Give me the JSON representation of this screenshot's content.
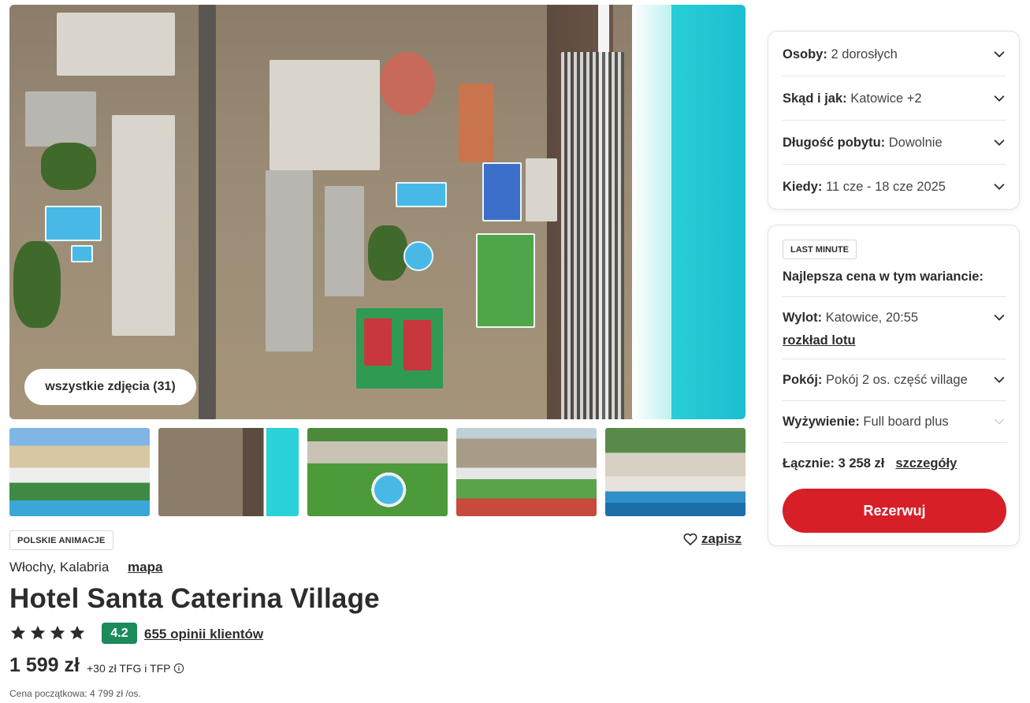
{
  "gallery": {
    "all_photos_label": "wszystkie zdjęcia (31)",
    "thumbnails": [
      "hotel-view",
      "aerial-beach",
      "pool-area",
      "resort-overview",
      "beach-umbrellas"
    ]
  },
  "hotel": {
    "badge": "POLSKIE ANIMACJE",
    "save_label": "zapisz",
    "location": "Włochy, Kalabria",
    "map_label": "mapa",
    "name": "Hotel Santa Caterina Village",
    "stars": 4,
    "rating": "4.2",
    "reviews_label": "655 opinii klientów",
    "price": "1 599 zł",
    "price_extra": "+30 zł TFG i TFP",
    "price_initial": "Cena początkowa: 4 799 zł /os."
  },
  "search": {
    "persons_label": "Osoby:",
    "persons_value": "2 dorosłych",
    "from_label": "Skąd i jak:",
    "from_value": "Katowice +2",
    "duration_label": "Długość pobytu:",
    "duration_value": "Dowolnie",
    "when_label": "Kiedy:",
    "when_value": "11 cze - 18 cze 2025"
  },
  "offer": {
    "badge": "LAST MINUTE",
    "best_price": "Najlepsza cena w tym wariancie:",
    "flight_label": "Wylot:",
    "flight_value": "Katowice, 20:55",
    "flight_schedule": "rozkład lotu",
    "room_label": "Pokój:",
    "room_value": "Pokój 2 os. część village",
    "board_label": "Wyżywienie:",
    "board_value": "Full board plus",
    "total_label": "Łącznie: 3 258 zł",
    "details_label": "szczegóły",
    "book_label": "Rezerwuj"
  },
  "colors": {
    "accent_red": "#d71f28",
    "rating_green": "#1c8a5a",
    "text": "#2c2c2c"
  }
}
